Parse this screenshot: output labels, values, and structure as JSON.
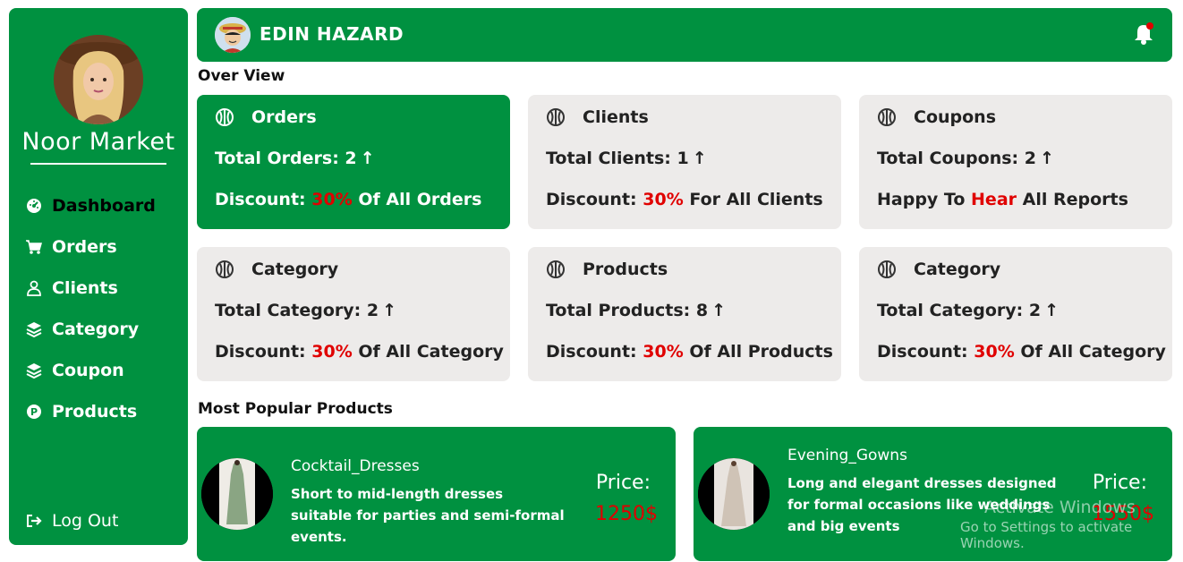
{
  "sidebar": {
    "brand": "Noor Market",
    "items": [
      {
        "label": "Dashboard",
        "icon": "dashboard-gauge-icon",
        "active": true
      },
      {
        "label": "Orders",
        "icon": "cart-icon"
      },
      {
        "label": "Clients",
        "icon": "user-icon"
      },
      {
        "label": "Category",
        "icon": "layers-icon"
      },
      {
        "label": "Coupon",
        "icon": "layers-icon"
      },
      {
        "label": "Products",
        "icon": "product-circle-icon"
      }
    ],
    "logout": "Log Out"
  },
  "header": {
    "user_name": "EDIN HAZARD"
  },
  "overview": {
    "title": "Over View",
    "cards": [
      {
        "title": "Orders",
        "line1": "Total Orders: 2",
        "line2_pre": "Discount: ",
        "line2_red": "30%",
        "line2_post": " Of All Orders"
      },
      {
        "title": "Clients",
        "line1": "Total Clients: 1",
        "line2_pre": "Discount: ",
        "line2_red": "30%",
        "line2_post": " For All Clients"
      },
      {
        "title": "Coupons",
        "line1": "Total Coupons: 2",
        "line2_pre": "Happy To ",
        "line2_red": "Hear",
        "line2_post": " All Reports"
      },
      {
        "title": "Category",
        "line1": "Total Category: 2",
        "line2_pre": "Discount: ",
        "line2_red": "30%",
        "line2_post": " Of All Category"
      },
      {
        "title": "Products",
        "line1": "Total Products: 8",
        "line2_pre": "Discount: ",
        "line2_red": "30%",
        "line2_post": " Of All Products"
      },
      {
        "title": "Category",
        "line1": "Total Category: 2",
        "line2_pre": "Discount: ",
        "line2_red": "30%",
        "line2_post": " Of All Category"
      }
    ],
    "arrow": "↑"
  },
  "popular": {
    "title": "Most Popular Products",
    "products": [
      {
        "name": "Cocktail_Dresses",
        "desc": "Short to mid-length dresses suitable for parties and semi-formal events.",
        "price_label": "Price:",
        "price": "1250$"
      },
      {
        "name": "Evening_Gowns",
        "desc": "Long and elegant dresses designed for formal occasions like weddings and big events",
        "price_label": "Price:",
        "price": "1550$"
      }
    ]
  },
  "watermark": {
    "line1": "Activate Windows",
    "line2": "Go to Settings to activate Windows."
  },
  "colors": {
    "accent": "#009140",
    "card": "#edebea",
    "highlight": "#e00000"
  }
}
